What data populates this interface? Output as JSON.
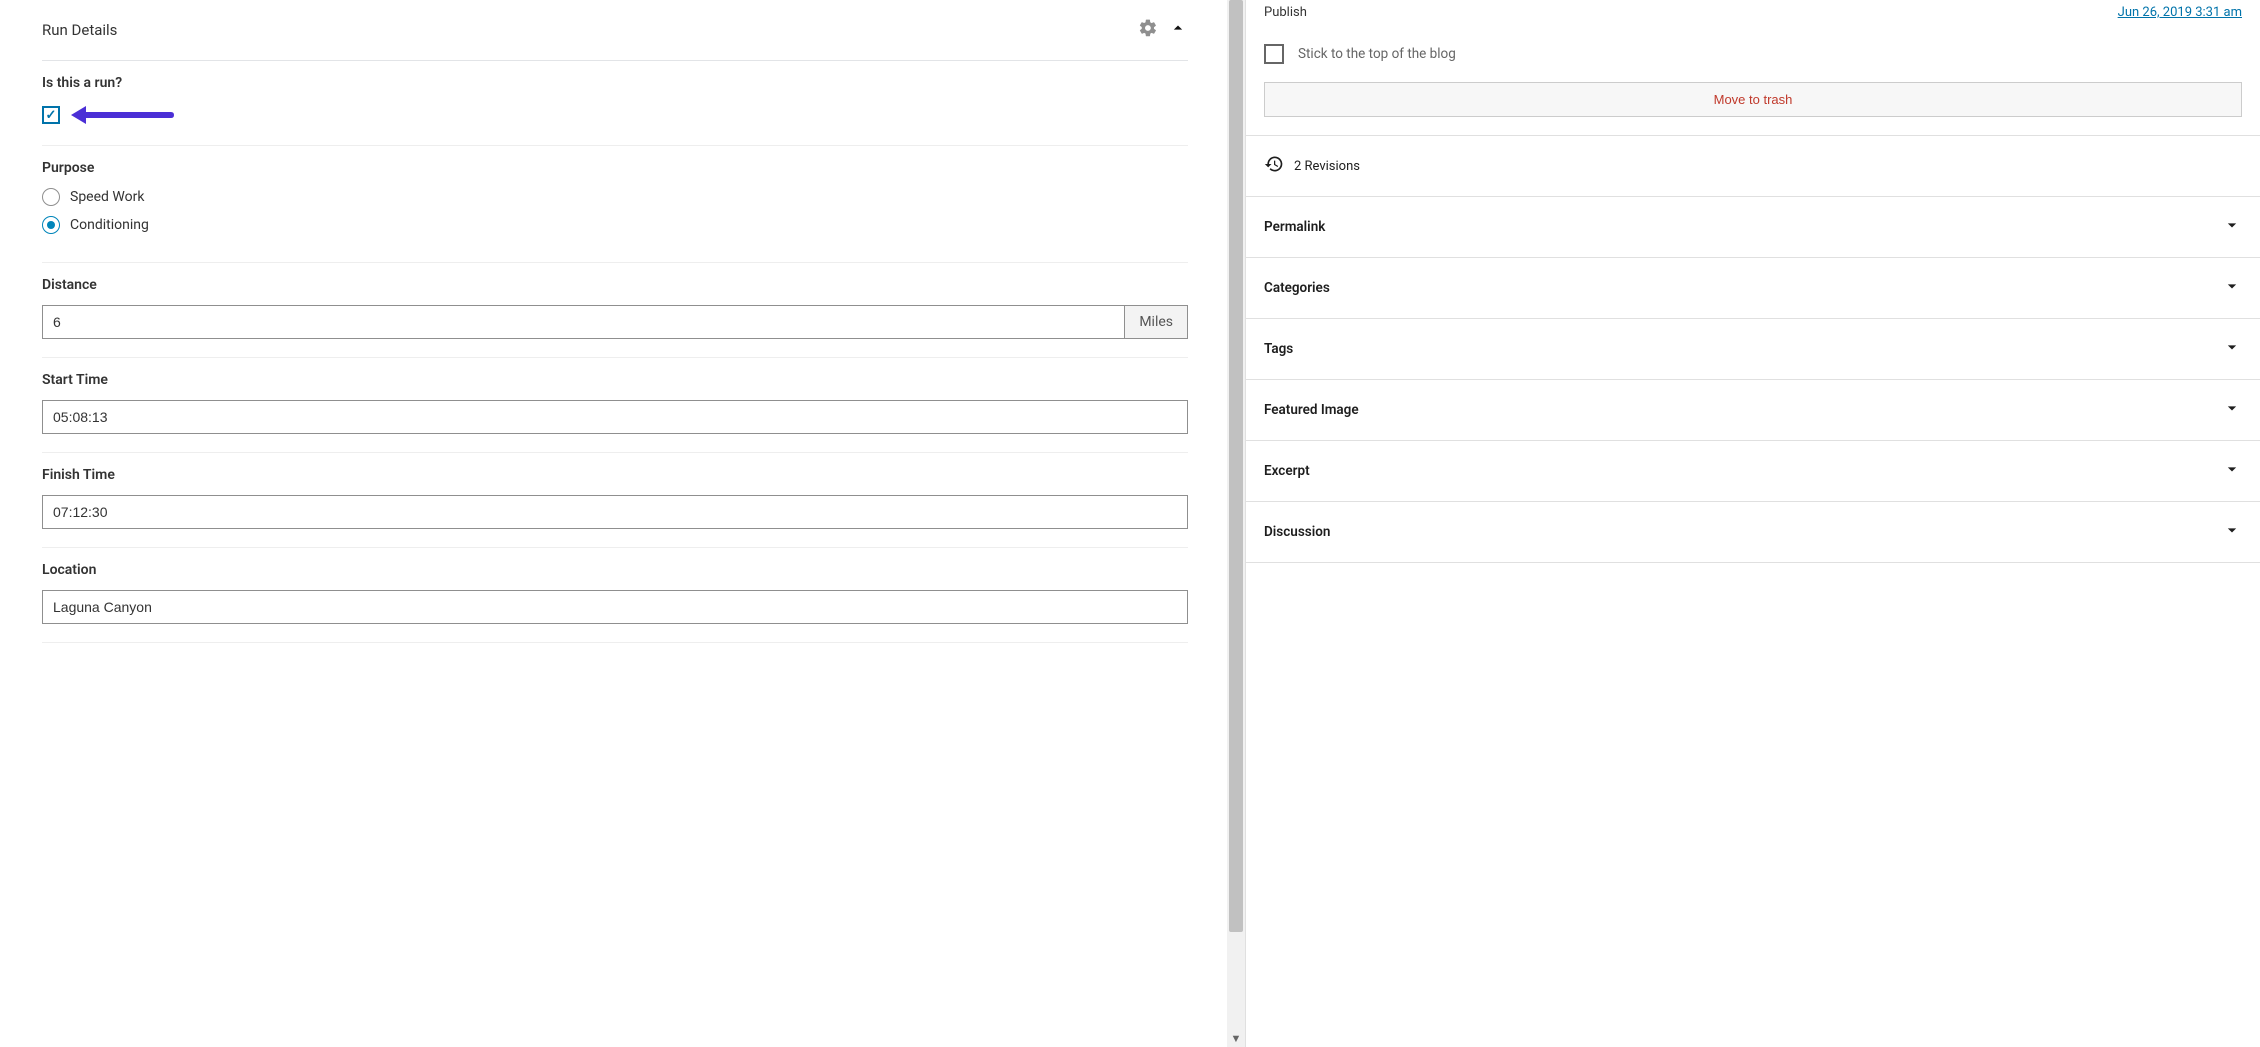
{
  "panel": {
    "title": "Run Details"
  },
  "fields": {
    "is_run": {
      "label": "Is this a run?",
      "checked": true
    },
    "purpose": {
      "label": "Purpose",
      "options": {
        "speed": "Speed Work",
        "conditioning": "Conditioning"
      },
      "selected": "conditioning"
    },
    "distance": {
      "label": "Distance",
      "value": "6",
      "unit": "Miles"
    },
    "start_time": {
      "label": "Start Time",
      "value": "05:08:13"
    },
    "finish_time": {
      "label": "Finish Time",
      "value": "07:12:30"
    },
    "location": {
      "label": "Location",
      "value": "Laguna Canyon"
    }
  },
  "sidebar": {
    "publish_label": "Publish",
    "publish_date": "Jun 26, 2019 3:31 am",
    "stick_label": "Stick to the top of the blog",
    "trash_label": "Move to trash",
    "revisions_label": "2 Revisions",
    "accordion": {
      "permalink": "Permalink",
      "categories": "Categories",
      "tags": "Tags",
      "featured_image": "Featured Image",
      "excerpt": "Excerpt",
      "discussion": "Discussion"
    }
  }
}
